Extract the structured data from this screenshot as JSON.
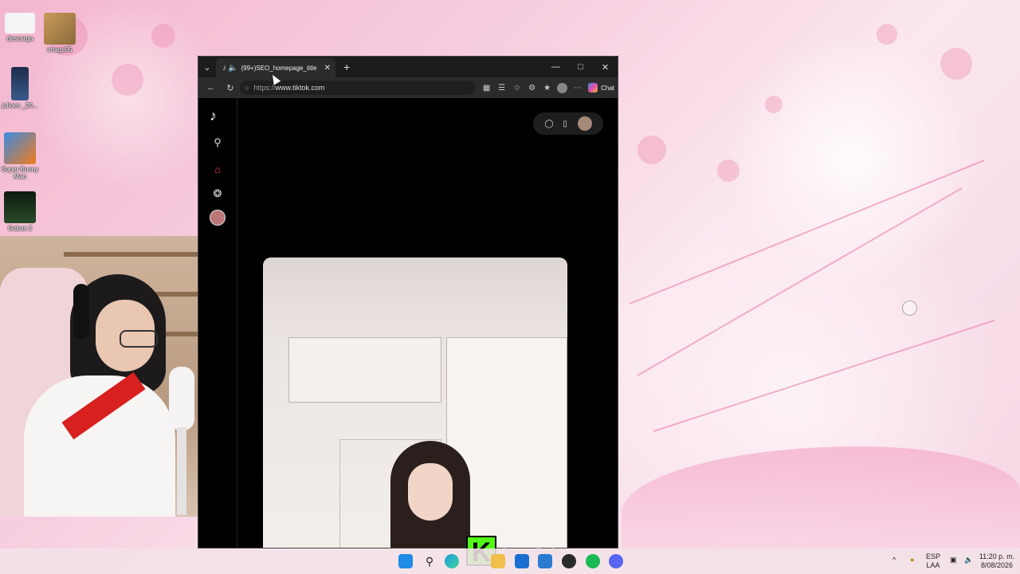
{
  "desktop": {
    "icons": [
      {
        "label": "descarga"
      },
      {
        "label": "image05"
      },
      {
        "label": "julioes _20..."
      },
      {
        "label": "Super Bunny Man"
      },
      {
        "label": "Gobas 2"
      }
    ]
  },
  "browser": {
    "tab_title": "(99+)SEO_homepage_title",
    "url_scheme": "https://",
    "url_host": "www.tiktok.com",
    "chat_label": "Chat",
    "tab_list_icon": "chevron-down-icon",
    "window_controls": [
      "minimize-icon",
      "maximize-icon",
      "close-icon"
    ]
  },
  "overlay": {
    "kick_letter": "K",
    "streamer_name": "JessyBaby"
  },
  "taskbar": {
    "language": "ESP",
    "layout": "LAA",
    "time": "11:20 p. m.",
    "date": "8/08/2026"
  },
  "colors": {
    "tiktok_accent": "#fe2c55",
    "kick_green": "#53fc18",
    "edge_dark": "#1c1c1c"
  }
}
